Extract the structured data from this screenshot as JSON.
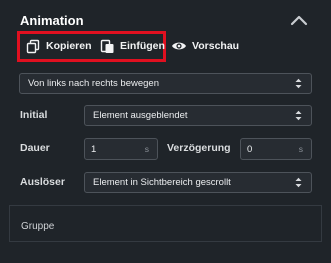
{
  "panel": {
    "title": "Animation"
  },
  "actions": {
    "copy_label": "Kopieren",
    "paste_label": "Einfügen",
    "preview_label": "Vorschau"
  },
  "effect": {
    "selected": "Von links nach rechts bewegen"
  },
  "initial": {
    "label": "Initial",
    "selected": "Element ausgeblendet"
  },
  "duration": {
    "label": "Dauer",
    "value": "1",
    "unit": "s"
  },
  "delay": {
    "label": "Verzögerung",
    "value": "0",
    "unit": "s"
  },
  "trigger": {
    "label": "Auslöser",
    "selected": "Element in Sichtbereich gescrollt"
  },
  "group": {
    "label": "Gruppe"
  },
  "colors": {
    "background": "#1f2429",
    "highlight": "#e01020",
    "field_border": "#4d535a",
    "text": "#eceef0"
  }
}
